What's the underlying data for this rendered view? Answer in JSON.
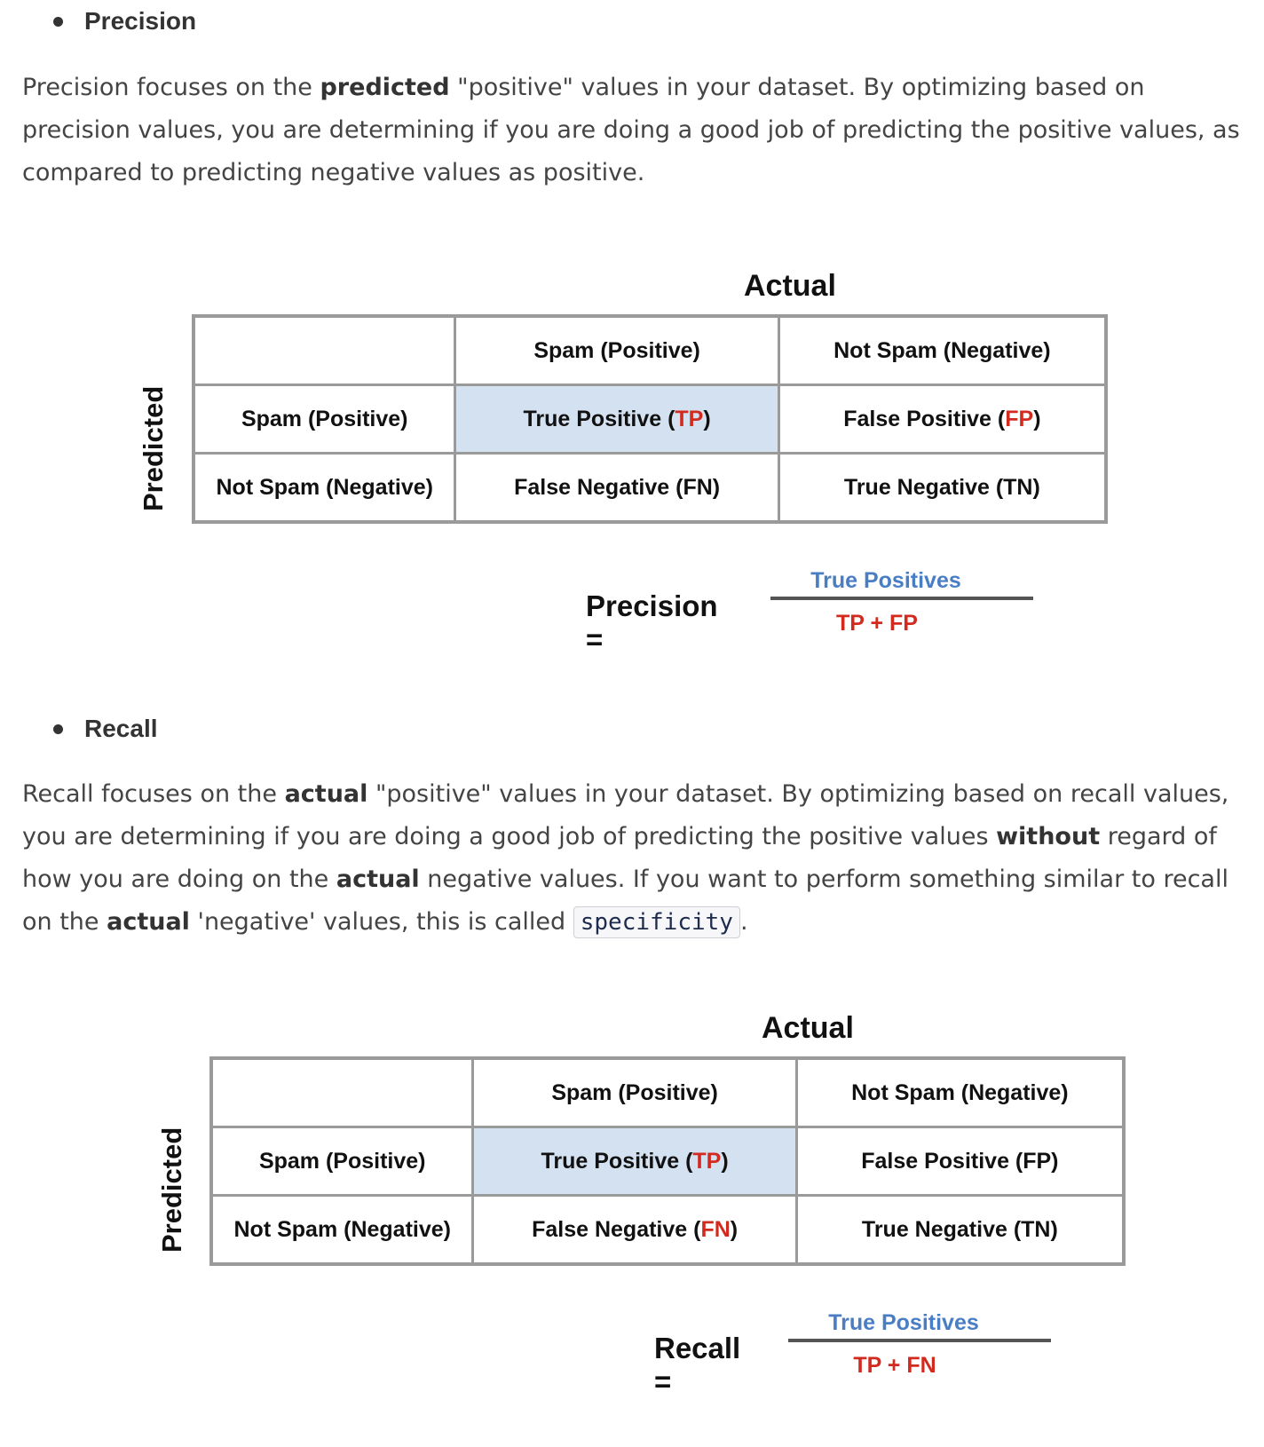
{
  "precision": {
    "heading": "Precision",
    "para": {
      "t1": "Precision focuses on the ",
      "b1": "predicted",
      "t2": " \"positive\" values in your dataset. By optimizing based on precision values, you are determining if you are doing a good job of predicting the positive values, as compared to predicting negative values as positive."
    },
    "figure": {
      "actual_label": "Actual",
      "predicted_label": "Predicted",
      "col_headers": [
        "Spam (Positive)",
        "Not Spam (Negative)"
      ],
      "row_headers": [
        "Spam (Positive)",
        "Not Spam (Negative)"
      ],
      "cells": {
        "tp_text": "True Positive (",
        "tp_abbr": "TP",
        "tp_close": ")",
        "fp_text": "False Positive (",
        "fp_abbr": "FP",
        "fp_close": ")",
        "fn_text": "False Negative (FN)",
        "tn_text": "True Negative (TN)"
      },
      "formula_name": "Precision =",
      "numerator": "True Positives",
      "denominator": "TP + FP"
    }
  },
  "recall": {
    "heading": "Recall",
    "para": {
      "t1": "Recall focuses on the ",
      "b1": "actual",
      "t2": " \"positive\" values in your dataset. By optimizing based on recall values, you are determining if you are doing a good job of predicting the positive values ",
      "b2": "without",
      "t3": " regard of how you are doing on the ",
      "b3": "actual",
      "t4": " negative values. If you want to perform something similar to recall on the ",
      "b4": "actual",
      "t5": " 'negative' values, this is called ",
      "code": "specificity",
      "t6": "."
    },
    "figure": {
      "actual_label": "Actual",
      "predicted_label": "Predicted",
      "col_headers": [
        "Spam (Positive)",
        "Not Spam (Negative)"
      ],
      "row_headers": [
        "Spam (Positive)",
        "Not Spam (Negative)"
      ],
      "cells": {
        "tp_text": "True Positive (",
        "tp_abbr": "TP",
        "tp_close": ")",
        "fp_text": "False Positive (FP)",
        "fn_text": "False Negative (",
        "fn_abbr": "FN",
        "fn_close": ")",
        "tn_text": "True Negative (TN)"
      },
      "formula_name": "Recall =",
      "numerator": "True Positives",
      "denominator": "TP + FN"
    }
  },
  "colors": {
    "highlight_cell": "#d4e1f0",
    "red_abbr": "#d22a1e",
    "numerator_blue": "#4a7ec4",
    "grid_gray": "#9a9a9a"
  }
}
